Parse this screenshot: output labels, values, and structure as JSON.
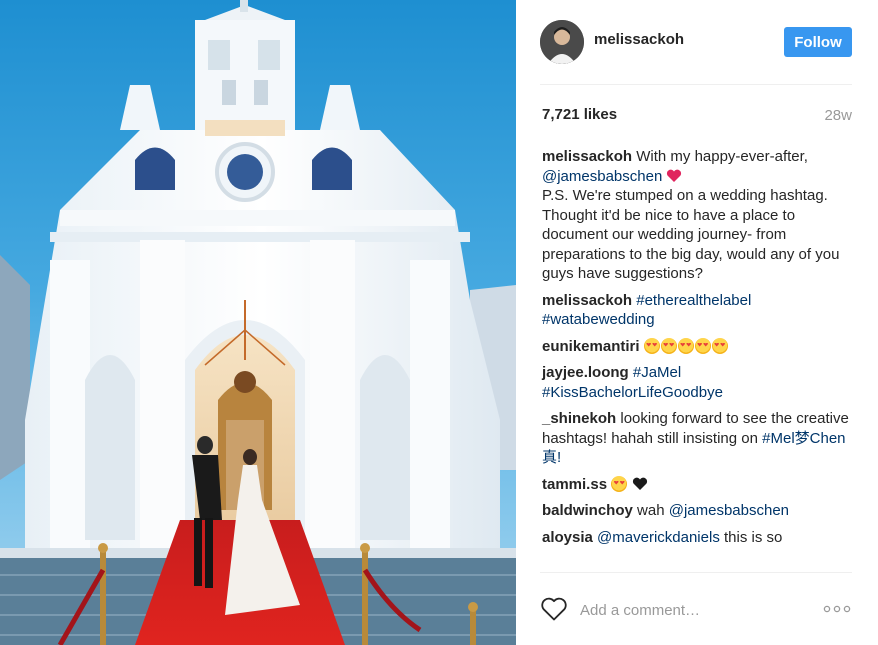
{
  "post": {
    "username": "melissackoh",
    "follow_label": "Follow",
    "likes": "7,721 likes",
    "age": "28w",
    "caption": {
      "user": "melissackoh",
      "text_before_mention": "With my happy-ever-after,",
      "mention": "@jamesbabschen",
      "heart_icon": "red-heart-icon",
      "body": "P.S. We're stumped on a wedding hashtag. Thought it'd be nice to have a place to document our wedding journey- from preparations to the big day, would any of you guys have suggestions?"
    },
    "comments": [
      {
        "user": "melissackoh",
        "text": "#etherealthelabel #watabewedding"
      },
      {
        "user": "eunikemantiri",
        "emoji": "heart-eyes-emoji-x5"
      },
      {
        "user": "jayjee.loong",
        "text": "#JaMel #KissBachelorLifeGoodbye"
      },
      {
        "user": "_shinekoh",
        "text": "looking forward to see the creative hashtags! hahah still insisting on",
        "tag": "#Mel梦Chen真!"
      },
      {
        "user": "tammi.ss",
        "emoji": "heart-eyes-emoji-and-black-heart"
      },
      {
        "user": "baldwinchoy",
        "text": "wah",
        "mention": "@jamesbabschen"
      },
      {
        "user": "aloysia",
        "mention": "@maverickdaniels",
        "text": "this is so"
      }
    ]
  },
  "footer": {
    "comment_placeholder": "Add a comment…",
    "like_icon": "heart-outline-icon",
    "more_icon": "more-options-icon"
  },
  "photo": {
    "subject": "church-wedding-photo"
  },
  "colors": {
    "follow_button": "#3897f0",
    "link": "#003569",
    "muted": "#999999",
    "divider": "#efefef"
  }
}
